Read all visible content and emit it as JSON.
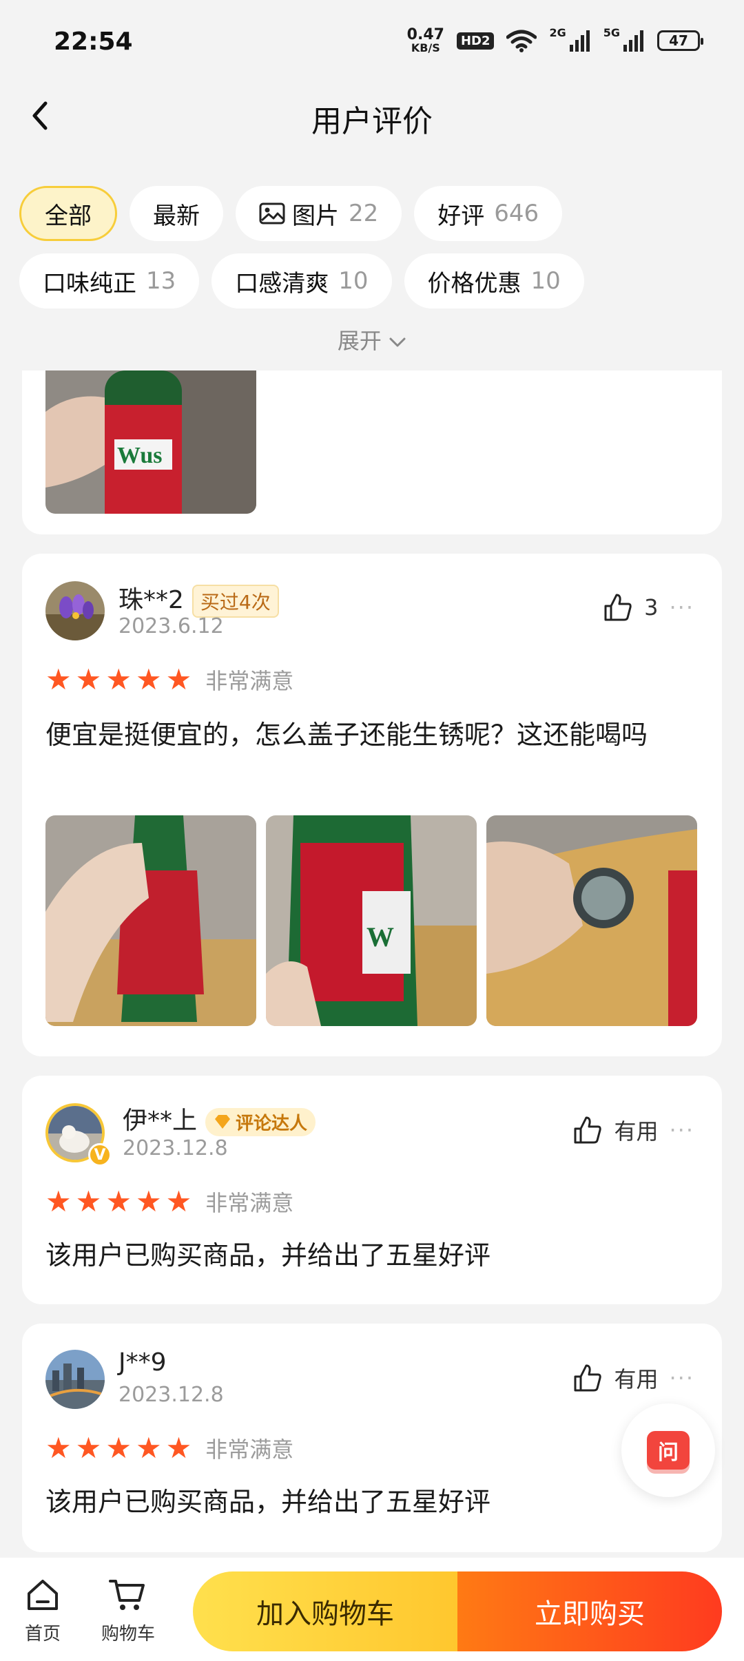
{
  "status_bar": {
    "time": "22:54",
    "net_speed_value": "0.47",
    "net_speed_unit": "KB/S",
    "hd_label": "HD2",
    "signal_1_label": "2G",
    "signal_2_label": "5G",
    "battery": "47"
  },
  "header": {
    "title": "用户评价"
  },
  "filters": {
    "all": {
      "label": "全部"
    },
    "latest": {
      "label": "最新"
    },
    "images": {
      "label": "图片",
      "count": "22"
    },
    "good": {
      "label": "好评",
      "count": "646"
    },
    "taste_pure": {
      "label": "口味纯正",
      "count": "13"
    },
    "refreshing": {
      "label": "口感清爽",
      "count": "10"
    },
    "price": {
      "label": "价格优惠",
      "count": "10"
    },
    "expand_label": "展开"
  },
  "reviews": [
    {
      "user": "珠**2",
      "badge": "买过4次",
      "date": "2023.6.12",
      "likes": "3",
      "rating": 5,
      "rating_label": "非常满意",
      "content": "便宜是挺便宜的，怎么盖子还能生锈呢？这还能喝吗"
    },
    {
      "user": "伊**上",
      "badge": "评论达人",
      "date": "2023.12.8",
      "like_label": "有用",
      "rating": 5,
      "rating_label": "非常满意",
      "content": "该用户已购买商品，并给出了五星好评"
    },
    {
      "user": "J**9",
      "date": "2023.12.8",
      "like_label": "有用",
      "rating": 5,
      "rating_label": "非常满意",
      "content": "该用户已购买商品，并给出了五星好评"
    }
  ],
  "ask_button": {
    "label": "问"
  },
  "bottom_nav": {
    "home": "首页",
    "cart": "购物车",
    "add_to_cart": "加入购物车",
    "buy_now": "立即购买"
  },
  "colors": {
    "star": "#ff5722",
    "chip_active_bg": "#fdf3c9",
    "chip_active_border": "#f7cd3a",
    "cart_button": "#ffd43b",
    "buy_button": "#ff4d1f"
  }
}
